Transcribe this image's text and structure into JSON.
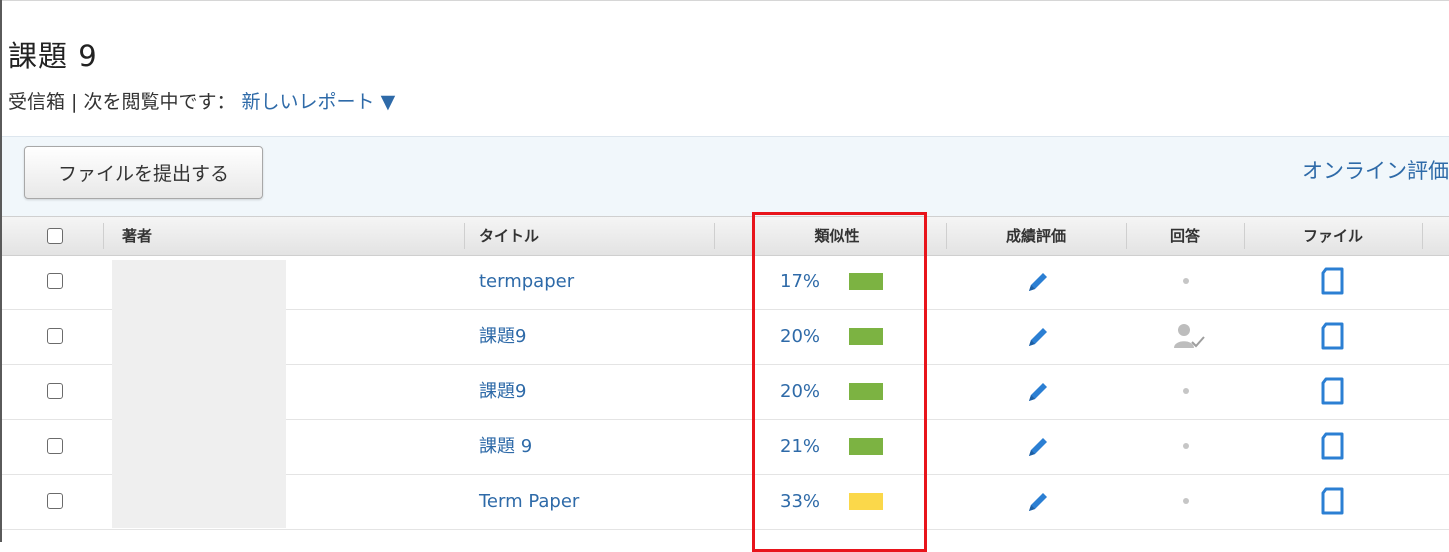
{
  "page": {
    "title": "課題 9",
    "inbox_prefix": "受信箱 | 次を閲覧中です：",
    "view_selector": "新しいレポート ▼"
  },
  "toolbar": {
    "submit_label": "ファイルを提出する",
    "online_grading_label": "オンライン評価"
  },
  "table": {
    "headers": {
      "author": "著者",
      "title": "タイトル",
      "similarity": "類似性",
      "grade": "成績評価",
      "response": "回答",
      "file": "ファイル"
    },
    "rows": [
      {
        "title": "termpaper",
        "similarity": "17%",
        "similarity_color": "#7cb342",
        "response": "none"
      },
      {
        "title": "課題9",
        "similarity": "20%",
        "similarity_color": "#7cb342",
        "response": "viewed"
      },
      {
        "title": "課題9",
        "similarity": "20%",
        "similarity_color": "#7cb342",
        "response": "none"
      },
      {
        "title": "課題 9",
        "similarity": "21%",
        "similarity_color": "#7cb342",
        "response": "none"
      },
      {
        "title": "Term Paper",
        "similarity": "33%",
        "similarity_color": "#fbd84a",
        "response": "none"
      }
    ]
  },
  "colors": {
    "link": "#2e6aa8",
    "highlight": "#e8141b",
    "icon_blue": "#2b7fd3"
  },
  "icons": {
    "grade": "pencil-icon",
    "response_none": "dot-icon",
    "response_viewed": "person-check-icon",
    "file": "document-icon"
  }
}
